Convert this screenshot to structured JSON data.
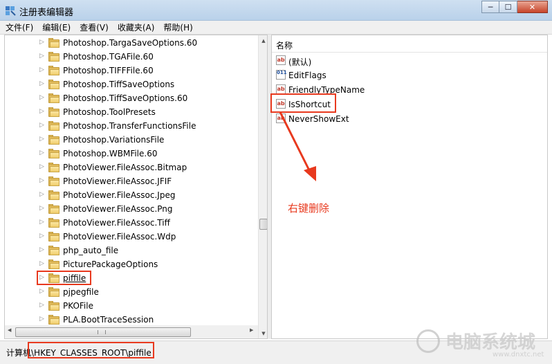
{
  "window": {
    "title": "注册表编辑器",
    "minimize_glyph": "─",
    "maximize_glyph": "☐",
    "close_glyph": "✕"
  },
  "menu": [
    "文件(F)",
    "编辑(E)",
    "查看(V)",
    "收藏夹(A)",
    "帮助(H)"
  ],
  "tree": {
    "items": [
      "Photoshop.TargaSaveOptions.60",
      "Photoshop.TGAFile.60",
      "Photoshop.TIFFFile.60",
      "Photoshop.TiffSaveOptions",
      "Photoshop.TiffSaveOptions.60",
      "Photoshop.ToolPresets",
      "Photoshop.TransferFunctionsFile",
      "Photoshop.VariationsFile",
      "Photoshop.WBMFile.60",
      "PhotoViewer.FileAssoc.Bitmap",
      "PhotoViewer.FileAssoc.JFIF",
      "PhotoViewer.FileAssoc.Jpeg",
      "PhotoViewer.FileAssoc.Png",
      "PhotoViewer.FileAssoc.Tiff",
      "PhotoViewer.FileAssoc.Wdp",
      "php_auto_file",
      "PicturePackageOptions",
      "piffile",
      "pjpegfile",
      "PKOFile",
      "PLA.BootTraceSession"
    ],
    "selected": "piffile",
    "expand_glyph": "▷"
  },
  "values": {
    "column_name": "名称",
    "items": [
      {
        "name": "(默认)",
        "icon": "string-value-icon",
        "badge": "ab"
      },
      {
        "name": "EditFlags",
        "icon": "binary-value-icon",
        "badge": "011"
      },
      {
        "name": "FriendlyTypeName",
        "icon": "string-value-icon",
        "badge": "ab"
      },
      {
        "name": "IsShortcut",
        "icon": "string-value-icon",
        "badge": "ab"
      },
      {
        "name": "NeverShowExt",
        "icon": "string-value-icon",
        "badge": "ab"
      }
    ]
  },
  "annotation": "右键删除",
  "status_path": "计算机\\HKEY_CLASSES_ROOT\\piffile",
  "watermark": {
    "brand": "电脑系统城",
    "url": "www.dnxtc.net"
  },
  "colors": {
    "highlight": "#e8391e",
    "folder": "#e3bd5d",
    "titlebar": "#cfe0f1"
  }
}
